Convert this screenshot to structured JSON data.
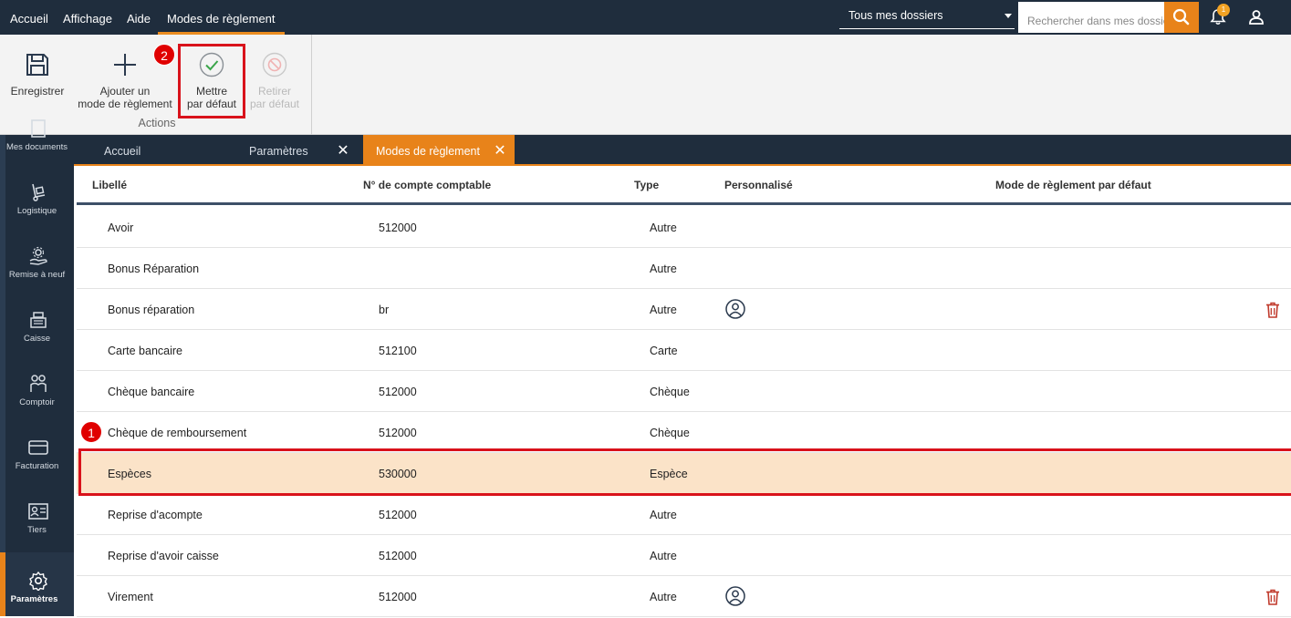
{
  "menu": {
    "items": [
      {
        "label": "Accueil"
      },
      {
        "label": "Affichage"
      },
      {
        "label": "Aide"
      },
      {
        "label": "Modes de règlement"
      }
    ],
    "folder_select": "Tous mes dossiers",
    "search_placeholder": "Rechercher dans mes dossiers",
    "notification_count": "1"
  },
  "ribbon": {
    "save_label": "Enregistrer",
    "add_label_1": "Ajouter un",
    "add_label_2": "mode de règlement",
    "set_default_label_1": "Mettre",
    "set_default_label_2": "par défaut",
    "remove_default_label_1": "Retirer",
    "remove_default_label_2": "par défaut",
    "group_label": "Actions"
  },
  "callouts": {
    "one": "1",
    "two": "2"
  },
  "sidebar": {
    "items": [
      {
        "label": "Mes documents"
      },
      {
        "label": "Logistique"
      },
      {
        "label": "Remise à neuf"
      },
      {
        "label": "Caisse"
      },
      {
        "label": "Comptoir"
      },
      {
        "label": "Facturation"
      },
      {
        "label": "Tiers"
      },
      {
        "label": "Paramètres"
      }
    ]
  },
  "tabs": [
    {
      "label": "Accueil"
    },
    {
      "label": "Paramètres"
    },
    {
      "label": "Modes de règlement"
    }
  ],
  "grid": {
    "columns": [
      "Libellé",
      "N° de compte comptable",
      "Type",
      "Personnalisé",
      "Mode de règlement par défaut"
    ],
    "rows": [
      {
        "libelle": "Avoir",
        "compte": "512000",
        "type": "Autre"
      },
      {
        "libelle": "Bonus Réparation",
        "compte": "",
        "type": "Autre"
      },
      {
        "libelle": "Bonus réparation",
        "compte": "br",
        "type": "Autre"
      },
      {
        "libelle": "Carte bancaire",
        "compte": "512100",
        "type": "Carte"
      },
      {
        "libelle": "Chèque bancaire",
        "compte": "512000",
        "type": "Chèque"
      },
      {
        "libelle": "Chèque de remboursement",
        "compte": "512000",
        "type": "Chèque"
      },
      {
        "libelle": "Espèces",
        "compte": "530000",
        "type": "Espèce"
      },
      {
        "libelle": "Reprise d'acompte",
        "compte": "512000",
        "type": "Autre"
      },
      {
        "libelle": "Reprise d'avoir caisse",
        "compte": "512000",
        "type": "Autre"
      },
      {
        "libelle": "Virement",
        "compte": "512000",
        "type": "Autre"
      }
    ]
  },
  "colors": {
    "navy": "#1f2d3d",
    "accent": "#e8831a",
    "selected_row": "#fbe3c8",
    "highlight_red": "#d9121b"
  }
}
